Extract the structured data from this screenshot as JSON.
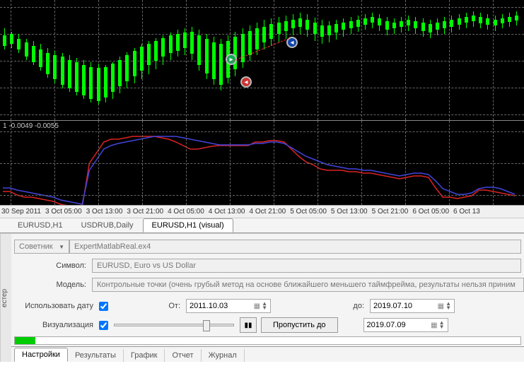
{
  "chart": {
    "time_ticks": [
      "30 Sep 2011",
      "3 Oct 05:00",
      "3 Oct 13:00",
      "3 Oct 21:00",
      "4 Oct 05:00",
      "4 Oct 13:00",
      "4 Oct 21:00",
      "5 Oct 05:00",
      "5 Oct 13:00",
      "5 Oct 21:00",
      "6 Oct 05:00",
      "6 Oct 13"
    ]
  },
  "indicator": {
    "label": "1 -0.0049 -0.0055"
  },
  "chart_tabs": [
    {
      "label": "EURUSD,H1",
      "active": false
    },
    {
      "label": "USDRUB,Daily",
      "active": false
    },
    {
      "label": "EURUSD,H1 (visual)",
      "active": true
    }
  ],
  "tester": {
    "vertical": "естер",
    "expert_label": "Советник",
    "expert_value": "ExpertMatlabReal.ex4",
    "symbol_label": "Символ:",
    "symbol_value": "EURUSD, Euro vs US Dollar",
    "model_label": "Модель:",
    "model_value": "Контрольные точки (очень грубый метод на основе ближайшего меньшего таймфрейма, результаты нельзя приним",
    "use_date_label": "Использовать дату",
    "from_label": "От:",
    "from_value": "2011.10.03",
    "to_label": "до:",
    "to_value": "2019.07.10",
    "visual_label": "Визуализация",
    "pause_glyph": "▮▮",
    "skip_label": "Пропустить до",
    "skip_date": "2019.07.09",
    "progress_pct": 4
  },
  "bottom_tabs": [
    {
      "label": "Настройки",
      "active": true
    },
    {
      "label": "Результаты",
      "active": false
    },
    {
      "label": "График",
      "active": false
    },
    {
      "label": "Отчет",
      "active": false
    },
    {
      "label": "Журнал",
      "active": false
    }
  ],
  "chart_data": {
    "type": "candlestick",
    "timeframe": "H1",
    "symbol": "EURUSD",
    "x_range": [
      "2011-09-30",
      "2011-10-06 13:00"
    ],
    "markers": [
      {
        "type": "buy",
        "x_idx": 28,
        "y": 82
      },
      {
        "type": "sell",
        "x_idx": 30,
        "y": 114
      },
      {
        "type": "close",
        "x_idx": 36,
        "y": 58
      }
    ],
    "indicator_series": [
      {
        "name": "line1",
        "color": "#c00",
        "points": [
          100,
          100,
          105,
          108,
          108,
          110,
          112,
          114,
          118,
          120,
          122,
          122,
          60,
          45,
          30,
          26,
          26,
          24,
          22,
          22,
          22,
          22,
          24,
          26,
          30,
          35,
          40,
          40,
          38,
          36,
          35,
          35,
          35,
          35,
          35,
          30,
          30,
          28,
          28,
          30,
          40,
          50,
          58,
          62,
          68,
          70,
          70,
          70,
          72,
          72,
          74,
          74,
          76,
          78,
          80,
          82,
          80,
          78,
          78,
          80,
          95,
          108,
          108,
          110,
          108,
          106,
          98,
          98,
          100,
          102,
          104,
          106
        ]
      },
      {
        "name": "line2",
        "color": "#33c",
        "points": [
          95,
          95,
          98,
          100,
          102,
          104,
          106,
          108,
          112,
          114,
          116,
          118,
          70,
          55,
          40,
          35,
          32,
          30,
          28,
          26,
          24,
          22,
          22,
          22,
          22,
          24,
          26,
          28,
          30,
          32,
          34,
          34,
          34,
          34,
          34,
          32,
          32,
          30,
          30,
          32,
          38,
          44,
          50,
          54,
          58,
          62,
          64,
          66,
          68,
          68,
          70,
          70,
          72,
          74,
          76,
          78,
          76,
          74,
          74,
          76,
          85,
          96,
          100,
          104,
          104,
          102,
          96,
          94,
          94,
          96,
          100,
          104
        ]
      }
    ]
  }
}
